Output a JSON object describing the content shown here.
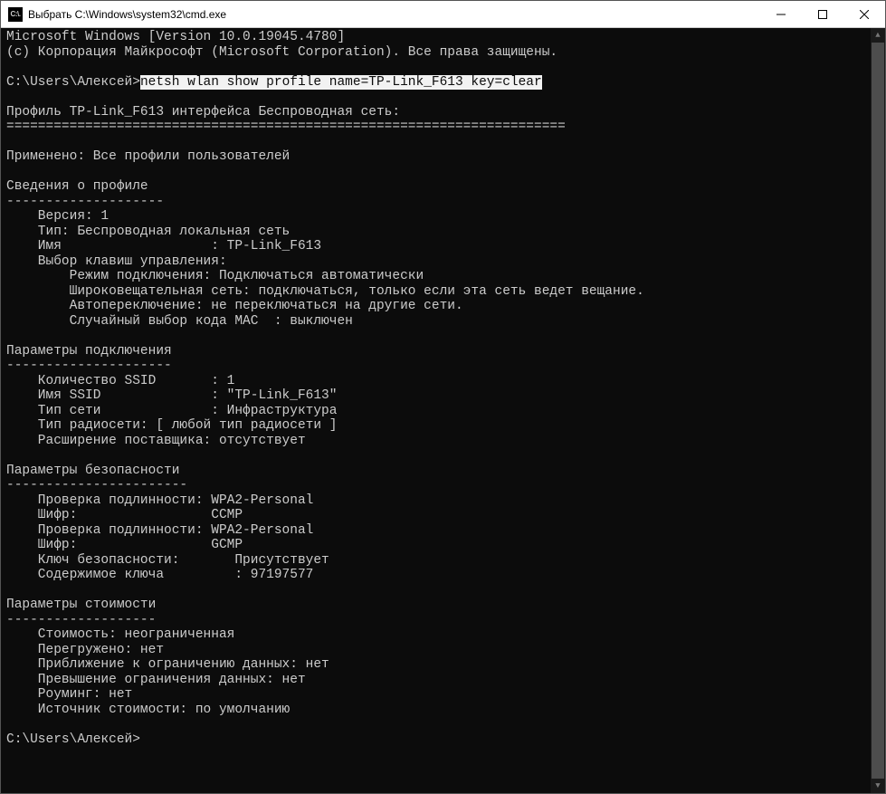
{
  "window": {
    "title": "Выбрать C:\\Windows\\system32\\cmd.exe",
    "icon_label": "C:\\."
  },
  "header": {
    "line1": "Microsoft Windows [Version 10.0.19045.4780]",
    "line2": "(c) Корпорация Майкрософт (Microsoft Corporation). Все права защищены."
  },
  "prompt1": {
    "path": "C:\\Users\\Алексей>",
    "command": "netsh wlan show profile name=TP-Link_F613 key=clear"
  },
  "profile_header": {
    "line": "Профиль TP-Link_F613 интерфейса Беспроводная сеть:",
    "rule": "======================================================================="
  },
  "applied": "Применено: Все профили пользователей",
  "section1": {
    "title": "Сведения о профиле",
    "rule": "--------------------",
    "version": "    Версия: 1",
    "type": "    Тип: Беспроводная локальная сеть",
    "name": "    Имя                   : TP-Link_F613",
    "keysel": "    Выбор клавиш управления:",
    "connmode": "        Режим подключения: Подключаться автоматически",
    "broadcast": "        Широковещательная сеть: подключаться, только если эта сеть ведет вещание.",
    "autoswitch": "        Автопереключение: не переключаться на другие сети.",
    "macrand": "        Случайный выбор кода MAC  : выключен"
  },
  "section2": {
    "title": "Параметры подключения",
    "rule": "---------------------",
    "ssidcount": "    Количество SSID       : 1",
    "ssidname": "    Имя SSID              : \"TP-Link_F613\"",
    "nettype": "    Тип сети              : Инфраструктура",
    "radiotype": "    Тип радиосети: [ любой тип радиосети ]",
    "vendorext": "    Расширение поставщика: отсутствует"
  },
  "section3": {
    "title": "Параметры безопасности",
    "rule": "-----------------------",
    "auth1": "    Проверка подлинности: WPA2-Personal",
    "cipher1": "    Шифр:                 CCMP",
    "auth2": "    Проверка подлинности: WPA2-Personal",
    "cipher2": "    Шифр:                 GCMP",
    "seckey": "    Ключ безопасности:       Присутствует",
    "keycont": "    Содержимое ключа         : 97197577"
  },
  "section4": {
    "title": "Параметры стоимости",
    "rule": "-------------------",
    "cost": "    Стоимость: неограниченная",
    "congested": "    Перегружено: нет",
    "neardata": "    Приближение к ограничению данных: нет",
    "overdata": "    Превышение ограничения данных: нет",
    "roaming": "    Роуминг: нет",
    "costsrc": "    Источник стоимости: по умолчанию"
  },
  "prompt2": {
    "path": "C:\\Users\\Алексей>"
  }
}
